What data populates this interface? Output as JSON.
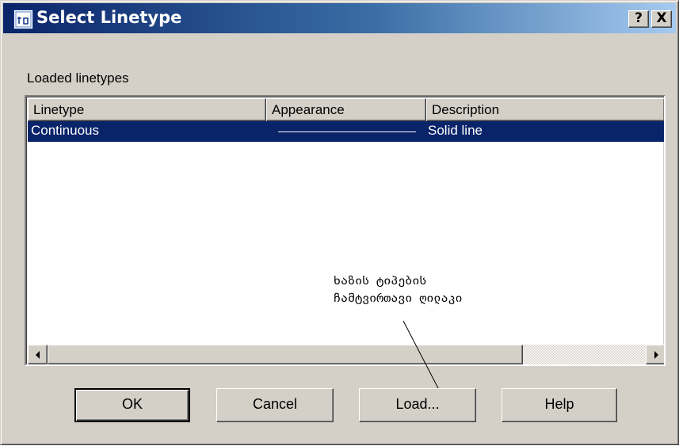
{
  "window": {
    "title": "Select Linetype",
    "help_button": "?",
    "close_button": "X",
    "icon": "app-icon"
  },
  "group_label": "Loaded linetypes",
  "list": {
    "columns": [
      "Linetype",
      "Appearance",
      "Description"
    ],
    "rows": [
      {
        "linetype": "Continuous",
        "appearance": "solid-line-sample",
        "description": "Solid line",
        "selected": true
      }
    ]
  },
  "annotation": {
    "line1": "ხაზის ტიპების",
    "line2": "ჩამტვირთავი ღილაკი"
  },
  "buttons": {
    "ok": "OK",
    "cancel": "Cancel",
    "load": "Load...",
    "help": "Help"
  },
  "colors": {
    "face": "#d4d0c8",
    "titlebar_start": "#0a246a",
    "titlebar_end": "#a6caf0",
    "selection": "#0a246a"
  }
}
